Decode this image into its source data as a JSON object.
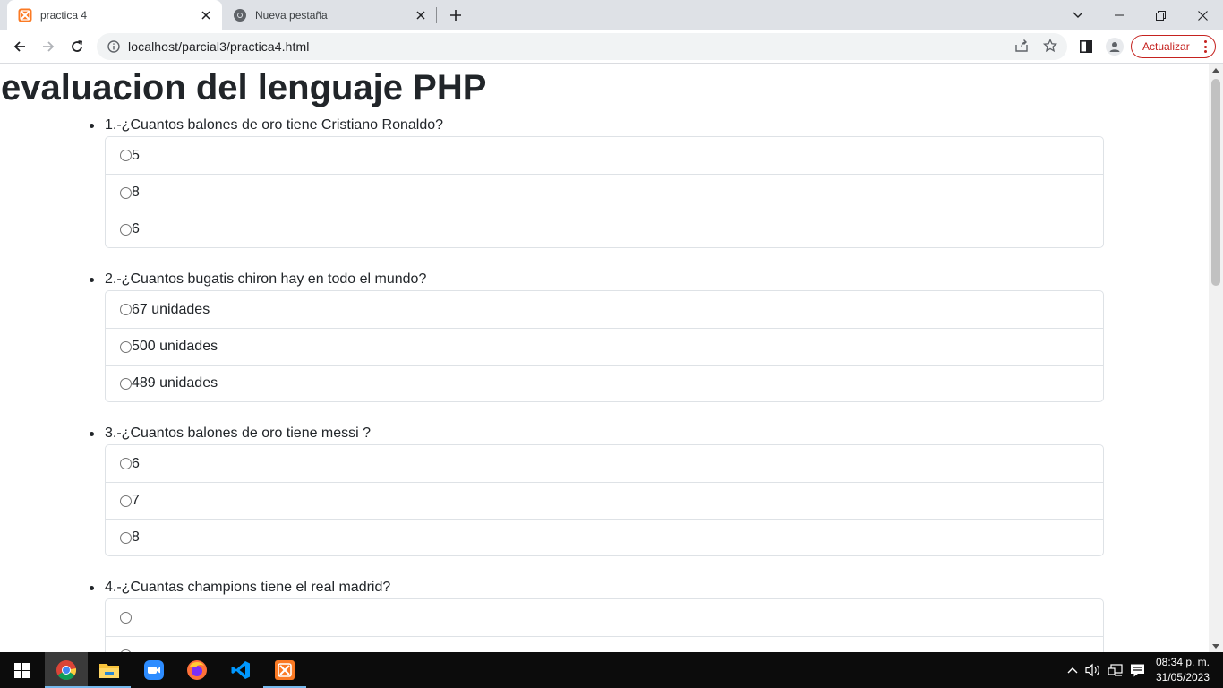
{
  "browser": {
    "tabs": [
      {
        "title": "practica 4",
        "active": true,
        "icon": "xampp-icon"
      },
      {
        "title": "Nueva pestaña",
        "active": false,
        "icon": "chrome-icon"
      }
    ],
    "url": "localhost/parcial3/practica4.html",
    "update_label": "Actualizar",
    "accent_color": "#c5221f"
  },
  "page": {
    "title": "evaluacion del lenguaje PHP",
    "questions": [
      {
        "text": "1.-¿Cuantos balones de oro tiene Cristiano Ronaldo?",
        "options": [
          "5",
          "8",
          "6"
        ]
      },
      {
        "text": "2.-¿Cuantos bugatis chiron hay en todo el mundo?",
        "options": [
          "67 unidades",
          "500 unidades",
          "489 unidades"
        ]
      },
      {
        "text": "3.-¿Cuantos balones de oro tiene messi ?",
        "options": [
          "6",
          "7",
          "8"
        ]
      },
      {
        "text": "4.-¿Cuantas champions tiene el real madrid?",
        "options": [
          "",
          ""
        ]
      }
    ]
  },
  "taskbar": {
    "apps": [
      "start-icon",
      "chrome-icon",
      "file-explorer-icon",
      "zoom-icon",
      "firefox-icon",
      "vscode-icon",
      "xampp-icon"
    ],
    "time": "08:34 p. m.",
    "date": "31/05/2023"
  }
}
